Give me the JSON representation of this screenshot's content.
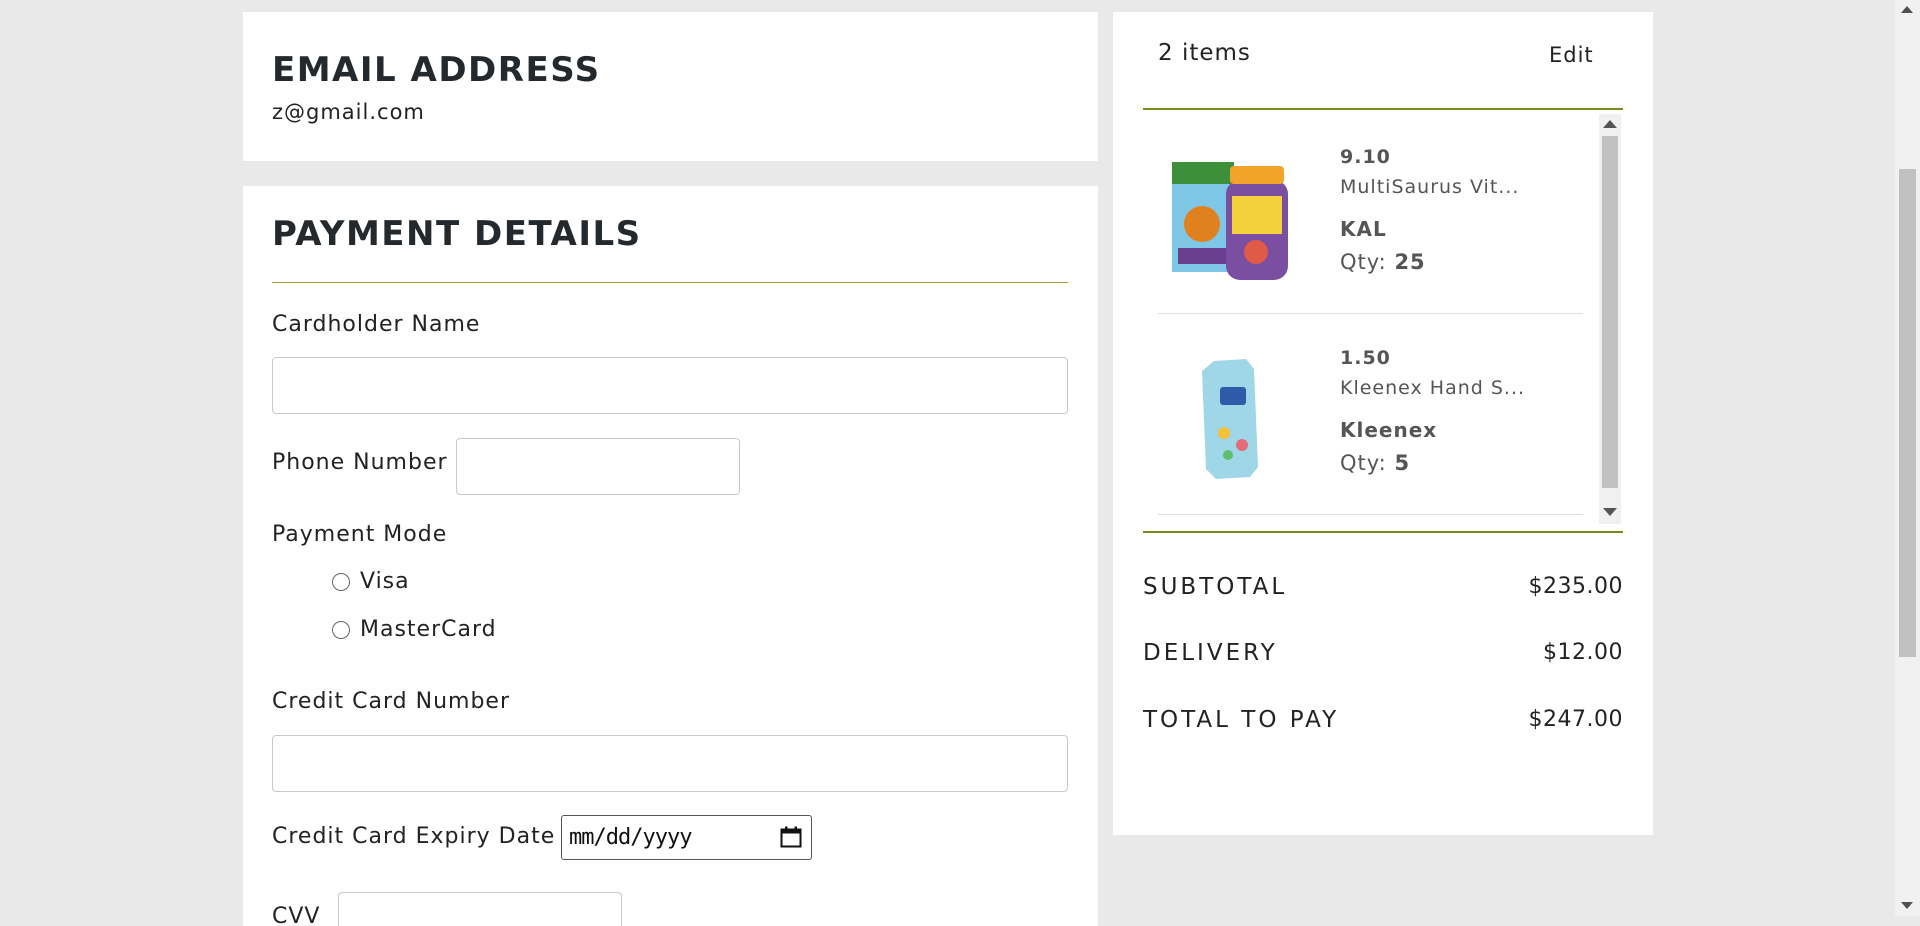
{
  "email_section": {
    "title": "EMAIL ADDRESS",
    "value": "z@gmail.com"
  },
  "payment_section": {
    "title": "PAYMENT DETAILS",
    "cardholder_label": "Cardholder Name",
    "phone_label": "Phone Number",
    "payment_mode_label": "Payment Mode",
    "modes": [
      {
        "label": "Visa",
        "selected": false
      },
      {
        "label": "MasterCard",
        "selected": false
      }
    ],
    "card_number_label": "Credit Card Number",
    "expiry_label": "Credit Card Expiry Date",
    "expiry_placeholder": "mm/dd/yyyy",
    "cvv_label": "CVV"
  },
  "summary": {
    "items_count": "2 items",
    "edit_label": "Edit",
    "items": [
      {
        "price": "9.10",
        "name": "MultiSaurus Vit...",
        "brand": "KAL",
        "qty_label": "Qty:",
        "qty": "25"
      },
      {
        "price": "1.50",
        "name": "Kleenex Hand S...",
        "brand": "Kleenex",
        "qty_label": "Qty:",
        "qty": "5"
      }
    ],
    "subtotal_label": "SUBTOTAL",
    "subtotal_value": "$235.00",
    "delivery_label": "DELIVERY",
    "delivery_value": "$12.00",
    "total_label": "TOTAL TO PAY",
    "total_value": "$247.00"
  },
  "colors": {
    "accent_olive": "#7a8c1a",
    "rule_gold": "#a59a3c",
    "page_background": "#e9e9e9"
  },
  "icons": {
    "calendar": "calendar-icon",
    "scroll_up": "scroll-up-arrow-icon",
    "scroll_down": "scroll-down-arrow-icon"
  }
}
